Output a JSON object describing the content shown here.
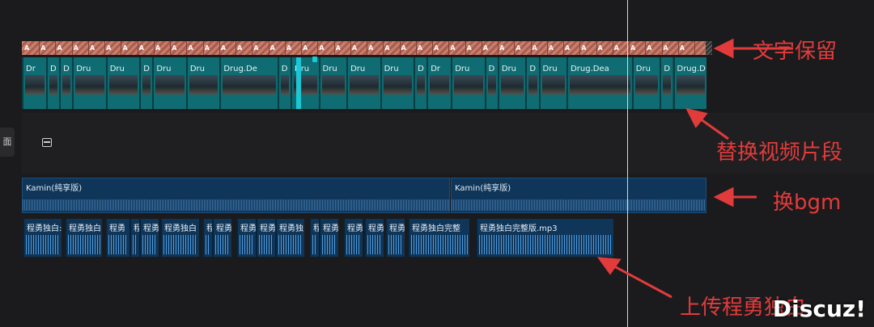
{
  "side_tab": {
    "label": "面"
  },
  "text_track": {
    "clip_labels": [
      "A",
      "A",
      "A",
      "A",
      "A",
      "A",
      "A",
      "A",
      "A",
      "A",
      "A",
      "A",
      "A",
      "A",
      "A",
      "A",
      "A",
      "A",
      "A",
      "A",
      "A",
      "A",
      "A",
      "A",
      "A",
      "A",
      "A",
      "A",
      "A",
      "A",
      "A",
      "A",
      "A",
      "A",
      "A",
      "A",
      "A",
      "A",
      "A",
      "A",
      "A"
    ]
  },
  "video_track": {
    "clips": [
      {
        "label": "Dr"
      },
      {
        "label": "D"
      },
      {
        "label": "D"
      },
      {
        "label": "Dru"
      },
      {
        "label": "Dru"
      },
      {
        "label": "D"
      },
      {
        "label": "Dru"
      },
      {
        "label": "Dru"
      },
      {
        "label": "Drug.De"
      },
      {
        "label": "D"
      },
      {
        "label": "Dru"
      },
      {
        "label": "Dru"
      },
      {
        "label": "Dru"
      },
      {
        "label": "Dru"
      },
      {
        "label": "D"
      },
      {
        "label": "Dr"
      },
      {
        "label": "Dru"
      },
      {
        "label": "D"
      },
      {
        "label": "Dru"
      },
      {
        "label": "D"
      },
      {
        "label": "Dru"
      },
      {
        "label": "Drug.Dea"
      },
      {
        "label": "Dru"
      },
      {
        "label": "D"
      },
      {
        "label": "Drug.D"
      }
    ]
  },
  "bgm_track": {
    "clips": [
      {
        "label": "Kamin(纯享版)"
      },
      {
        "label": "Kamin(纯享版)"
      }
    ]
  },
  "voice_track": {
    "clips": [
      {
        "label": "程勇独白:"
      },
      {
        "label": "程勇独白:"
      },
      {
        "label": "程勇"
      },
      {
        "label": "程"
      },
      {
        "label": "程勇"
      },
      {
        "label": "程勇独白"
      },
      {
        "label": "程"
      },
      {
        "label": "程勇"
      },
      {
        "label": "程勇"
      },
      {
        "label": "程勇"
      },
      {
        "label": "程勇独"
      },
      {
        "label": "程"
      },
      {
        "label": "程勇"
      },
      {
        "label": "程勇"
      },
      {
        "label": "程勇"
      },
      {
        "label": "程勇"
      },
      {
        "label": "程勇独白完整"
      },
      {
        "label": "程勇独白完整版.mp3"
      }
    ]
  },
  "annotations": {
    "text_keep": "文字保留",
    "replace_video": "替换视频片段",
    "replace_bgm": "换bgm",
    "upload_voice": "上传程勇独白"
  },
  "watermark": "Discuz!",
  "colors": {
    "text_track": "#c06a58",
    "video_track": "#0e6c72",
    "audio_track": "#0f3558",
    "annotation": "#e23b3b",
    "playhead": "#19c7d6"
  }
}
